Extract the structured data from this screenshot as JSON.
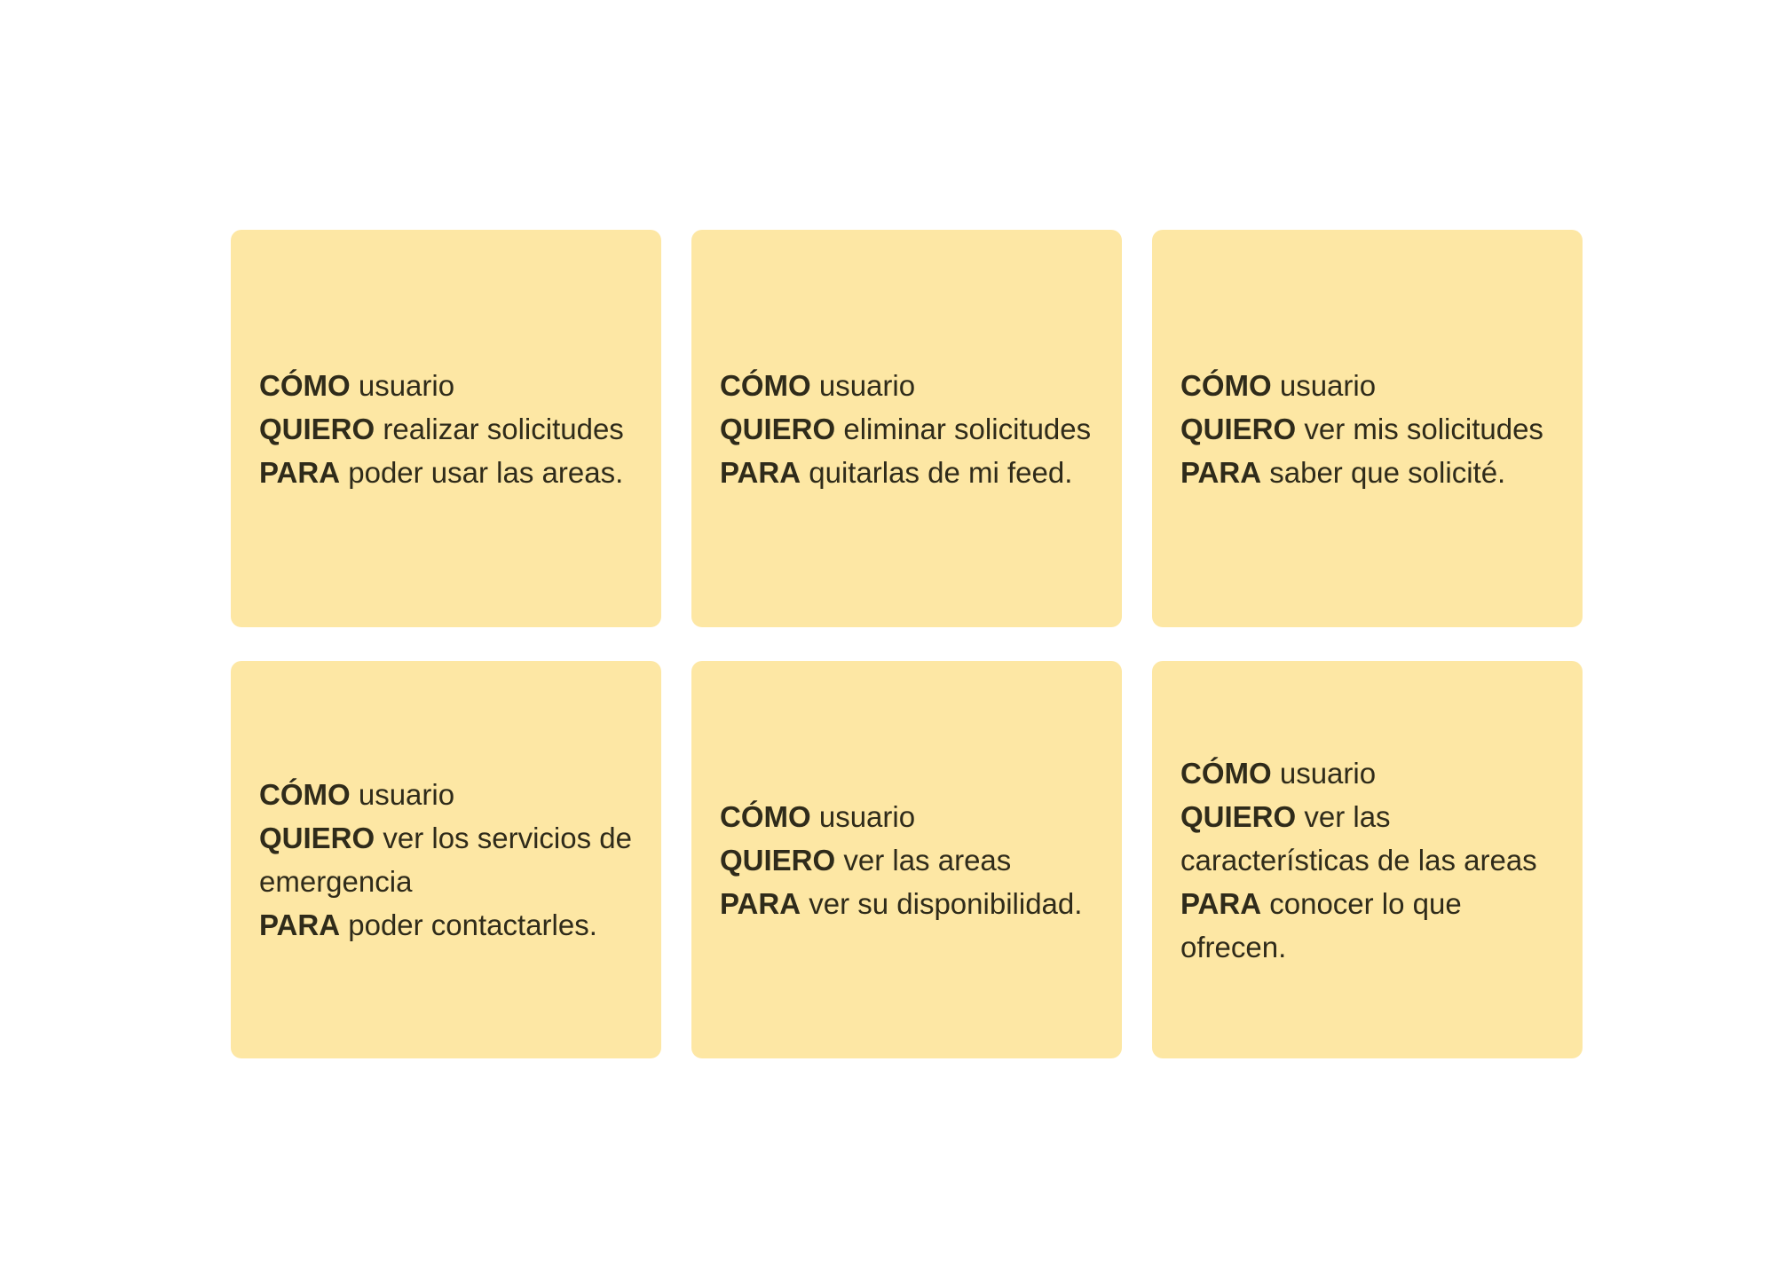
{
  "notes": [
    {
      "como_kw": "CÓMO",
      "como_text": "usuario",
      "quiero_kw": "QUIERO",
      "quiero_text": "realizar solicitudes",
      "para_kw": "PARA",
      "para_text": "poder usar las areas."
    },
    {
      "como_kw": "CÓMO",
      "como_text": "usuario",
      "quiero_kw": "QUIERO",
      "quiero_text": "eliminar solicitudes",
      "para_kw": "PARA",
      "para_text": "quitarlas de mi feed."
    },
    {
      "como_kw": "CÓMO",
      "como_text": "usuario",
      "quiero_kw": "QUIERO",
      "quiero_text": "ver mis solicitudes",
      "para_kw": "PARA",
      "para_text": "saber que solicité."
    },
    {
      "como_kw": "CÓMO",
      "como_text": "usuario",
      "quiero_kw": "QUIERO",
      "quiero_text": "ver los servicios de emergencia",
      "para_kw": "PARA",
      "para_text": "poder contactarles."
    },
    {
      "como_kw": "CÓMO",
      "como_text": "usuario",
      "quiero_kw": "QUIERO",
      "quiero_text": "ver las areas",
      "para_kw": "PARA",
      "para_text": "ver su disponibilidad."
    },
    {
      "como_kw": "CÓMO",
      "como_text": "usuario",
      "quiero_kw": "QUIERO",
      "quiero_text": "ver las características de las areas",
      "para_kw": "PARA",
      "para_text": "conocer lo que ofrecen."
    }
  ],
  "colors": {
    "note_background": "#fde7a4",
    "text": "#2f2b1a",
    "page_background": "#ffffff"
  }
}
